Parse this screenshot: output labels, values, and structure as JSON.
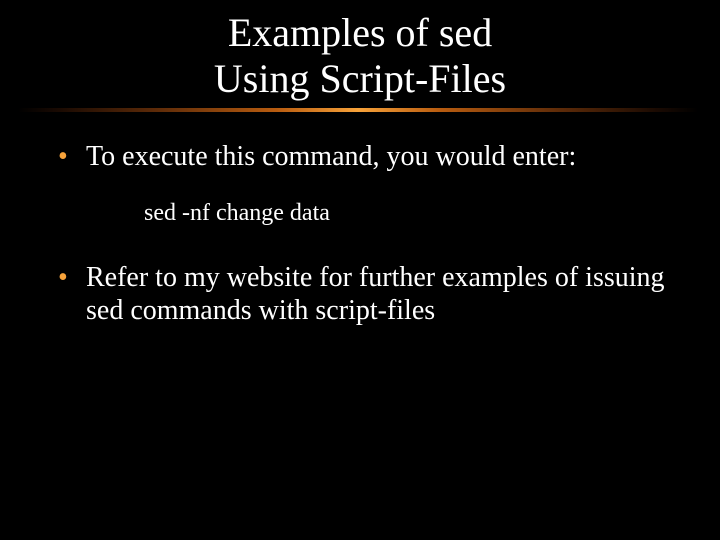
{
  "title": {
    "line1": "Examples of sed",
    "line2": "Using Script-Files"
  },
  "bullets": {
    "b1": "To execute this command, you would enter:",
    "example": "sed -nf change data",
    "b2": "Refer to my website for further examples of issuing sed commands with script-files"
  }
}
